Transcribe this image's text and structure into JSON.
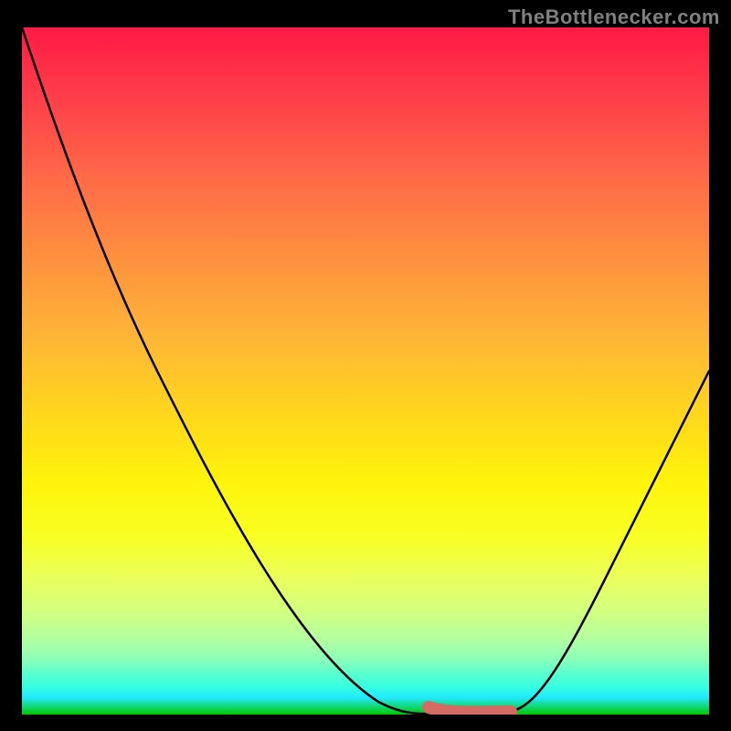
{
  "watermark": "TheBottlenecker.com",
  "colors": {
    "frame_background": "#000000",
    "curve_stroke": "#000000",
    "optimal_marker": "#d46a62",
    "watermark_text": "#808080",
    "gradient_top": "#ff1a45",
    "gradient_mid": "#fff30b",
    "gradient_bottom": "#00c800"
  },
  "chart_data": {
    "type": "line",
    "title": "",
    "xlabel": "",
    "ylabel": "",
    "xlim": [
      0,
      100
    ],
    "ylim": [
      0,
      100
    ],
    "grid": false,
    "legend": false,
    "series": [
      {
        "name": "bottleneck_curve",
        "x": [
          0,
          5,
          10,
          15,
          20,
          25,
          30,
          35,
          40,
          45,
          50,
          55,
          58,
          62,
          66,
          70,
          75,
          80,
          85,
          90,
          95,
          100
        ],
        "values": [
          100,
          92,
          83,
          74,
          65,
          56,
          47,
          38,
          29,
          20,
          11,
          4,
          1,
          0,
          0,
          1,
          7,
          16,
          26,
          36,
          44,
          50
        ]
      }
    ],
    "annotations": [
      {
        "name": "optimal_range",
        "x_start": 59,
        "x_end": 71,
        "y": 0,
        "color": "#d46a62"
      }
    ],
    "background": {
      "type": "vertical_gradient",
      "semantics": "heatmap red=bad yellow=moderate green=good",
      "stops": [
        {
          "pos": 0.0,
          "color": "#ff1a45"
        },
        {
          "pos": 0.33,
          "color": "#ff8e3f"
        },
        {
          "pos": 0.66,
          "color": "#fff30b"
        },
        {
          "pos": 0.9,
          "color": "#8affb8"
        },
        {
          "pos": 1.0,
          "color": "#00c800"
        }
      ]
    }
  }
}
